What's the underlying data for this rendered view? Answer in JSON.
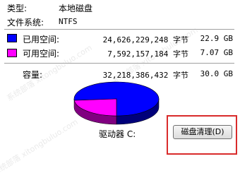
{
  "type_label": "类型:",
  "type_value": "本地磁盘",
  "fs_label": "文件系统:",
  "fs_value": "NTFS",
  "used": {
    "label": "已用空间:",
    "bytes": "24,626,229,248 字节",
    "size": "22.9 GB",
    "color": "#0000ff"
  },
  "free": {
    "label": "可用空间:",
    "bytes": "7,592,157,184 字节",
    "size": "7.07 GB",
    "color": "#ff00ff"
  },
  "capacity": {
    "label": "容量:",
    "bytes": "32,218,386,432 字节",
    "size": "30.0 GB"
  },
  "drive_label": "驱动器 C:",
  "cleanup_button": "磁盘清理(D)",
  "pie": {
    "used_fraction": 0.764,
    "free_fraction": 0.236
  }
}
